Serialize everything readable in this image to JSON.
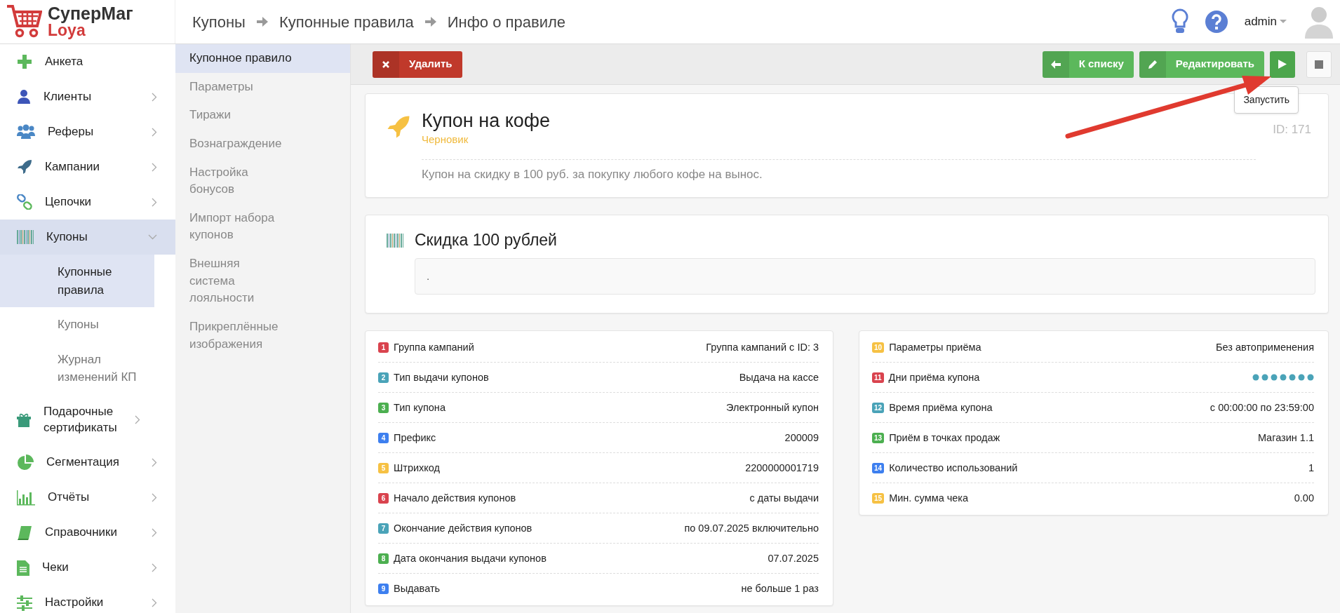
{
  "logo": {
    "title": "СуперМаг",
    "subtitle": "Loya"
  },
  "breadcrumbs": [
    "Купоны",
    "Купонные правила",
    "Инфо о правиле"
  ],
  "user": {
    "name": "admin"
  },
  "sidebar": {
    "items": [
      {
        "label": "Анкета"
      },
      {
        "label": "Клиенты",
        "expanded": false
      },
      {
        "label": "Реферы",
        "expanded": false
      },
      {
        "label": "Кампании",
        "expanded": false
      },
      {
        "label": "Цепочки",
        "expanded": false
      },
      {
        "label": "Купоны",
        "expanded": true,
        "children": [
          {
            "label": "Купонные правила",
            "selected": true
          },
          {
            "label": "Купоны",
            "selected": false
          },
          {
            "label": "Журнал изменений КП",
            "selected": false
          }
        ]
      },
      {
        "label": "Подарочные сертификаты",
        "expanded": false
      },
      {
        "label": "Сегментация",
        "expanded": false
      },
      {
        "label": "Отчёты",
        "expanded": false
      },
      {
        "label": "Справочники",
        "expanded": false
      },
      {
        "label": "Чеки",
        "expanded": false
      },
      {
        "label": "Настройки",
        "expanded": false
      }
    ]
  },
  "subnav": [
    {
      "label": "Купонное правило",
      "selected": true
    },
    {
      "label": "Параметры",
      "selected": false
    },
    {
      "label": "Тиражи",
      "selected": false
    },
    {
      "label": "Вознаграждение",
      "selected": false
    },
    {
      "label": "Настройка бонусов",
      "selected": false
    },
    {
      "label": "Импорт набора купонов",
      "selected": false
    },
    {
      "label": "Внешняя система лояльности",
      "selected": false
    },
    {
      "label": "Прикреплённые изображения",
      "selected": false
    }
  ],
  "toolbar": {
    "delete": "Удалить",
    "back": "К списку",
    "edit": "Редактировать",
    "run_tooltip": "Запустить"
  },
  "rule": {
    "title": "Купон на кофе",
    "status": "Черновик",
    "id": "ID: 171",
    "description": "Купон на скидку в 100 руб. за покупку любого кофе на вынос."
  },
  "reward": {
    "title": "Скидка 100 рублей",
    "text": "."
  },
  "params_left": [
    {
      "badge": "1",
      "color": "#d9434e",
      "label": "Группа кампаний",
      "value": "Группа кампаний с ID: 3"
    },
    {
      "badge": "2",
      "color": "#4aa3b8",
      "label": "Тип выдачи купонов",
      "value": "Выдача на кассе"
    },
    {
      "badge": "3",
      "color": "#4caf50",
      "label": "Тип купона",
      "value": "Электронный купон"
    },
    {
      "badge": "4",
      "color": "#3d7fef",
      "label": "Префикс",
      "value": "200009"
    },
    {
      "badge": "5",
      "color": "#f6c143",
      "label": "Штрихкод",
      "value": "2200000001719"
    },
    {
      "badge": "6",
      "color": "#d9434e",
      "label": "Начало действия купонов",
      "value": "с даты выдачи"
    },
    {
      "badge": "7",
      "color": "#4aa3b8",
      "label": "Окончание действия купонов",
      "value": "по 09.07.2025 включительно"
    },
    {
      "badge": "8",
      "color": "#4caf50",
      "label": "Дата окончания выдачи купонов",
      "value": "07.07.2025"
    },
    {
      "badge": "9",
      "color": "#3d7fef",
      "label": "Выдавать",
      "value": "не больше 1 раз"
    }
  ],
  "params_right": [
    {
      "badge": "10",
      "color": "#f6c143",
      "label": "Параметры приёма",
      "kind": "text",
      "value": "Без автоприменения"
    },
    {
      "badge": "11",
      "color": "#d9434e",
      "label": "Дни приёма купона",
      "kind": "days"
    },
    {
      "badge": "12",
      "color": "#4aa3b8",
      "label": "Время приёма купона",
      "kind": "text",
      "value": "с 00:00:00 по 23:59:00"
    },
    {
      "badge": "13",
      "color": "#4caf50",
      "label": "Приём в точках продаж",
      "kind": "text",
      "value": "Магазин 1.1"
    },
    {
      "badge": "14",
      "color": "#3d7fef",
      "label": "Количество использований",
      "kind": "text",
      "value": "1"
    },
    {
      "badge": "15",
      "color": "#f6c143",
      "label": "Мин. сумма чека",
      "kind": "text",
      "value": "0.00"
    }
  ]
}
